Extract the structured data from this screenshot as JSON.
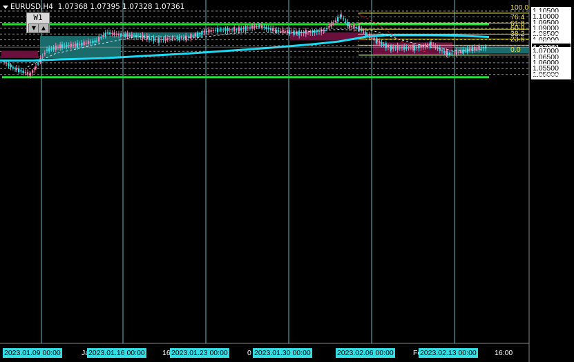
{
  "header": {
    "symbol": "EURUSD,H4",
    "ohlc": "1.07368 1.07395 1.07328 1.07361"
  },
  "timeframe_button": {
    "label": "W1",
    "prev_icon": "triangle-down-icon",
    "next_icon": "triangle-up-icon"
  },
  "price_axis": {
    "labels": [
      "1.10500",
      "1.10170",
      "1.10000",
      "1.09580",
      "1.09500",
      "1.09000",
      "1.08500",
      "1.08410",
      "1.08000",
      "1.07820",
      "1.07500",
      "1.07361",
      "1.07230",
      "1.07000",
      "1.06640",
      "1.06500",
      "1.06060",
      "1.06000",
      "1.05500",
      "1.05000",
      "1.04880"
    ],
    "current_price": "1.07361"
  },
  "fibonacci_levels": [
    "100.0",
    "76.4",
    "61.8",
    "50.0",
    "38.2",
    "23.6",
    "0.0"
  ],
  "time_axis": {
    "labels": [
      "2023.01.09 00:00",
      "Ja",
      "2023.01.16 00:00",
      "16",
      "2023.01.23 00:00",
      "0",
      "2023.01.30 00:00",
      "2023.02.06 00:00",
      "Fe",
      "2023.02.13 00:00",
      "16:00"
    ]
  },
  "colors": {
    "background": "#000000",
    "bull_candle": "#33e0e8",
    "bear_candle": "#f07fb0",
    "ma_line": "#1ed7f0",
    "support_line": "#22e030",
    "fib_line": "#e6e04a",
    "demand_box": "#1a6b6b",
    "supply_box": "#6b0f3c"
  },
  "chart_data": {
    "type": "candlestick",
    "symbol": "EURUSD",
    "timeframe": "H4",
    "price_range": [
      1.047,
      1.1065
    ],
    "price_labels": [
      1.105,
      1.1017,
      1.1,
      1.0958,
      1.095,
      1.09,
      1.085,
      1.0841,
      1.08,
      1.0782,
      1.075,
      1.07361,
      1.0723,
      1.07,
      1.0664,
      1.065,
      1.0606,
      1.06,
      1.055,
      1.05,
      1.0488
    ],
    "horizontal_lines": [
      1.0935,
      1.0475
    ],
    "fibonacci": {
      "high": 1.1032,
      "low": 1.0667,
      "levels": [
        100.0,
        76.4,
        61.8,
        50.0,
        38.2,
        23.6,
        0.0
      ]
    },
    "weekly_separators": [
      "2023.01.09 00:00",
      "2023.01.16 00:00",
      "2023.01.23 00:00",
      "2023.01.30 00:00",
      "2023.02.06 00:00",
      "2023.02.13 00:00"
    ],
    "last_price": 1.07361
  }
}
